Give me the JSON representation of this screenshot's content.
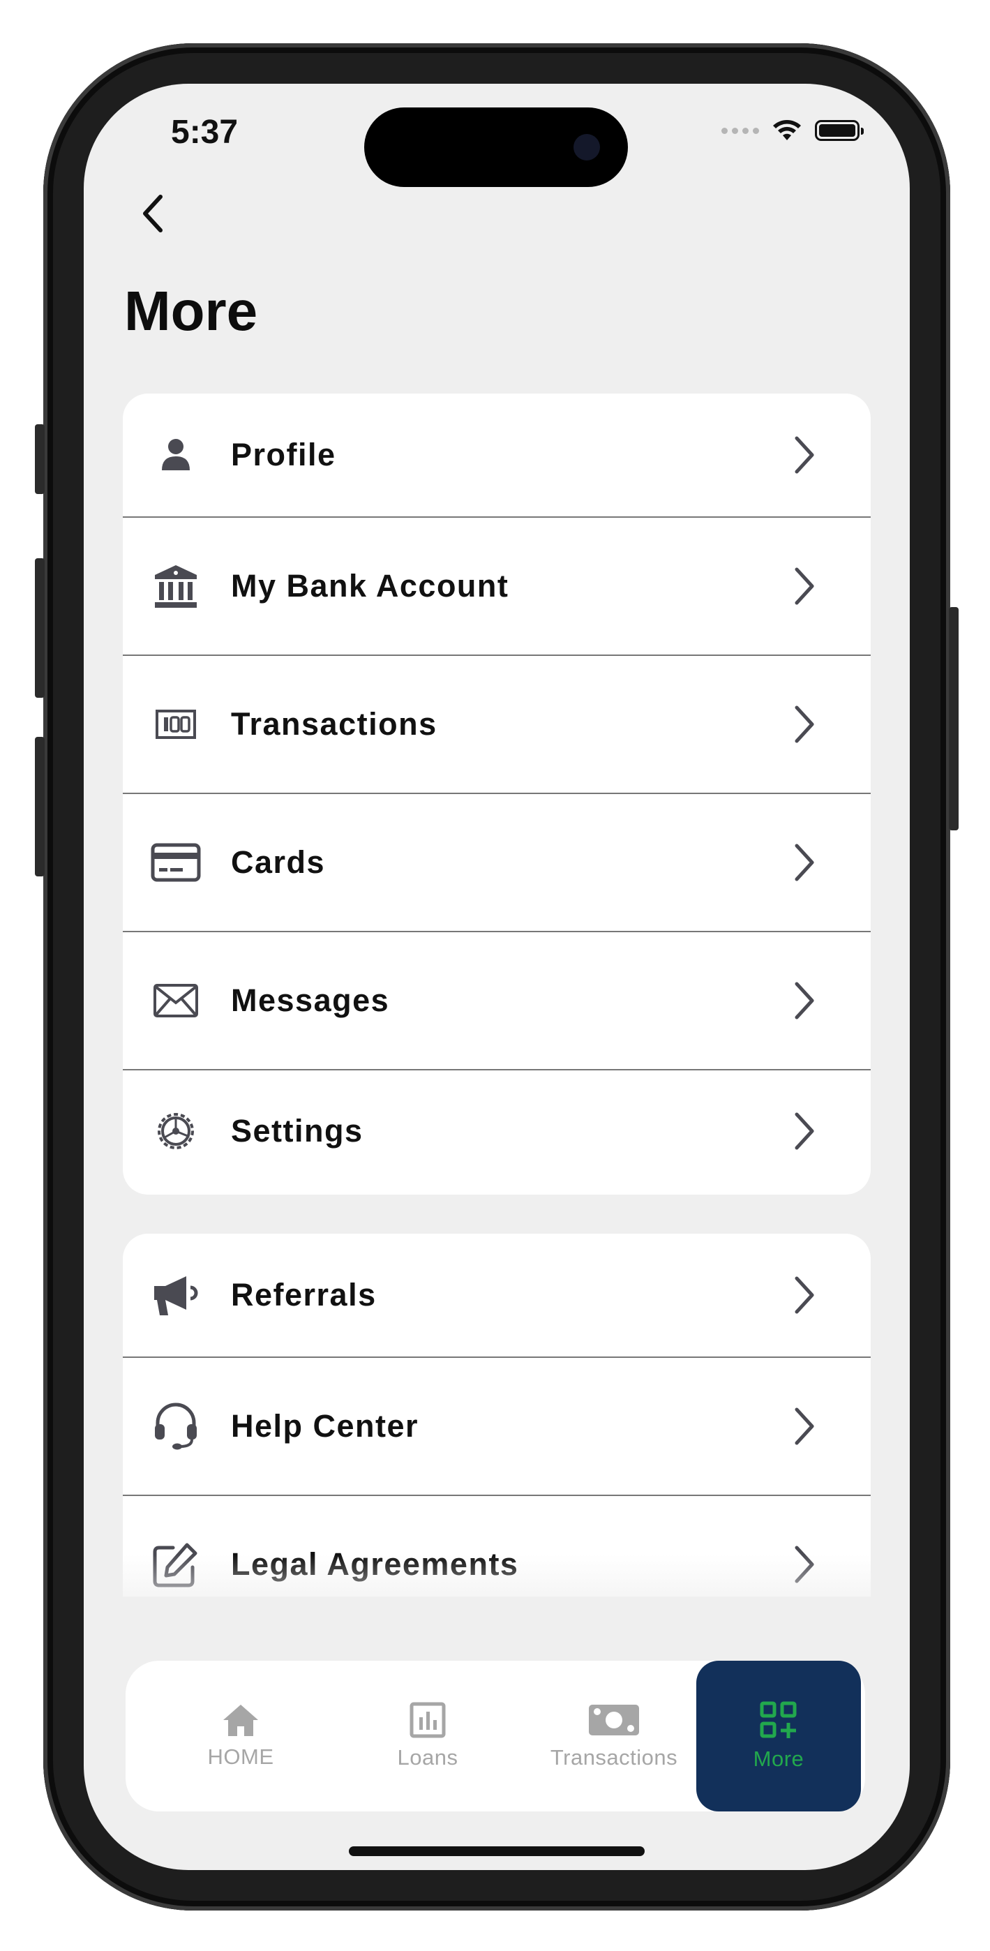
{
  "status_bar": {
    "time": "5:37"
  },
  "header": {
    "title": "More"
  },
  "groups": [
    {
      "items": [
        {
          "label": "Profile",
          "icon": "person-icon"
        },
        {
          "label": "My Bank Account",
          "icon": "bank-icon"
        },
        {
          "label": "Transactions",
          "icon": "banknote-icon"
        },
        {
          "label": "Cards",
          "icon": "credit-card-icon"
        },
        {
          "label": "Messages",
          "icon": "envelope-icon"
        },
        {
          "label": "Settings",
          "icon": "gear-icon"
        }
      ]
    },
    {
      "items": [
        {
          "label": "Referrals",
          "icon": "megaphone-icon"
        },
        {
          "label": "Help Center",
          "icon": "headset-icon"
        },
        {
          "label": "Legal Agreements",
          "icon": "edit-icon"
        }
      ]
    }
  ],
  "tabbar": {
    "tabs": [
      {
        "label": "HOME",
        "icon": "home-icon"
      },
      {
        "label": "Loans",
        "icon": "chart-icon"
      },
      {
        "label": "Transactions",
        "icon": "money-icon"
      },
      {
        "label": "More",
        "icon": "grid-plus-icon"
      }
    ],
    "active": "More"
  },
  "colors": {
    "accent": "#22a84d",
    "active_tab_bg": "#12305a",
    "screen_bg": "#efefef",
    "icon_gray": "#4a4a52",
    "inactive_tab": "#a6a6a6"
  }
}
